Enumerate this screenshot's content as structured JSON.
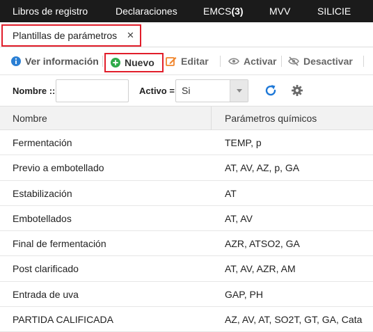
{
  "topnav": {
    "items": [
      {
        "label": "Libros de registro"
      },
      {
        "label": "Declaraciones"
      },
      {
        "label": "EMCS",
        "count": "(3)"
      },
      {
        "label": "MVV"
      },
      {
        "label": "SILICIE"
      }
    ]
  },
  "tabs": {
    "active_label": "Plantillas de parámetros",
    "close_glyph": "✕"
  },
  "toolbar": {
    "info_label": "Ver información",
    "new_label": "Nuevo",
    "edit_label": "Editar",
    "activate_label": "Activar",
    "deactivate_label": "Desactivar",
    "icons": [
      "info-icon",
      "plus-circle-icon",
      "edit-icon",
      "eye-icon",
      "eye-slash-icon"
    ],
    "colors": {
      "info": "#2a7fd4",
      "new": "#2eaa4a",
      "edit": "#f0852d"
    }
  },
  "filters": {
    "name_label": "Nombre ::",
    "name_value": "",
    "active_label": "Activo =",
    "active_value": "Si",
    "icons": [
      "refresh-icon",
      "gear-icon"
    ],
    "colors": {
      "refresh": "#1e78d7"
    }
  },
  "table": {
    "headers": [
      "Nombre",
      "Parámetros químicos"
    ],
    "rows": [
      {
        "name": "Fermentación",
        "params": "TEMP, p"
      },
      {
        "name": "Previo a embotellado",
        "params": "AT, AV, AZ, p, GA"
      },
      {
        "name": "Estabilización",
        "params": "AT"
      },
      {
        "name": "Embotellados",
        "params": "AT, AV"
      },
      {
        "name": "Final de fermentación",
        "params": "AZR, ATSO2, GA"
      },
      {
        "name": "Post clarificado",
        "params": "AT, AV, AZR, AM"
      },
      {
        "name": "Entrada de uva",
        "params": "GAP, PH"
      },
      {
        "name": "PARTIDA CALIFICADA",
        "params": "AZ, AV, AT, SO2T, GT, GA, Cata"
      }
    ]
  },
  "highlight_color": "#e11d2a"
}
